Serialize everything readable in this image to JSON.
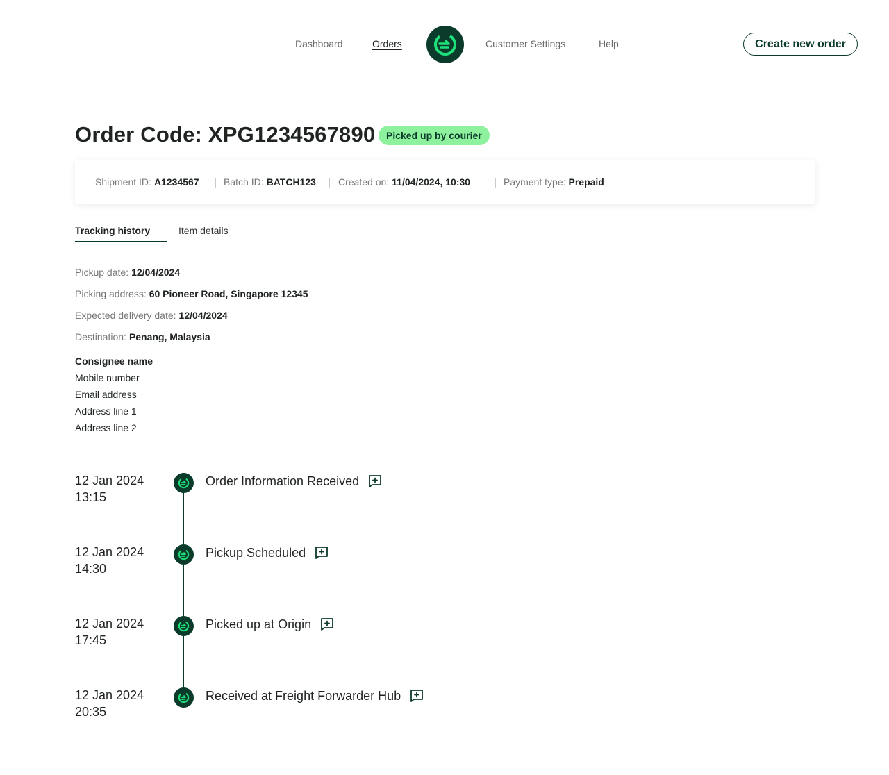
{
  "nav": {
    "links": [
      "Dashboard",
      "Orders",
      "Customer Settings",
      "Help"
    ],
    "active": "Orders",
    "logo_icon": "logo-icon",
    "create_button": "Create new order"
  },
  "colors": {
    "primary": "#0b3b2a",
    "accent": "#1ee07a",
    "badge_bg": "#8ef19e"
  },
  "order": {
    "title": "Order Code: XPG1234567890",
    "status": "Picked up by courier"
  },
  "info": {
    "shipment_label": "Shipment ID:",
    "shipment_value": "A1234567",
    "batch_label": "Batch ID:",
    "batch_value": "BATCH123",
    "created_label": "Created on:",
    "created_value": "11/04/2024, 10:30",
    "payment_label": "Payment type:",
    "payment_value": "Prepaid",
    "separator": "|"
  },
  "tabs": [
    "Tracking history",
    "Item details"
  ],
  "details": {
    "pickup_label": "Pickup date:",
    "pickup_value": "12/04/2024",
    "address_label": "Picking address:",
    "address_value": "60 Pioneer Road, Singapore 12345",
    "expected_label": "Expected delivery date:",
    "expected_value": "12/04/2024",
    "destination_label": "Destination:",
    "destination_value": "Penang, Malaysia"
  },
  "consignee": [
    "Consignee name",
    "Mobile number",
    "Email address",
    "Address line 1",
    "Address line 2"
  ],
  "timeline": [
    {
      "date": "12 Jan 2024",
      "time": "13:15",
      "title": "Order Information Received"
    },
    {
      "date": "12 Jan 2024",
      "time": "14:30",
      "title": "Pickup Scheduled"
    },
    {
      "date": "12 Jan 2024",
      "time": "17:45",
      "title": "Picked up at Origin"
    },
    {
      "date": "12 Jan 2024",
      "time": "20:35",
      "title": "Received at Freight Forwarder Hub"
    }
  ],
  "icons": {
    "status_icon": "status-check-icon",
    "note_icon": "add-note-icon"
  }
}
